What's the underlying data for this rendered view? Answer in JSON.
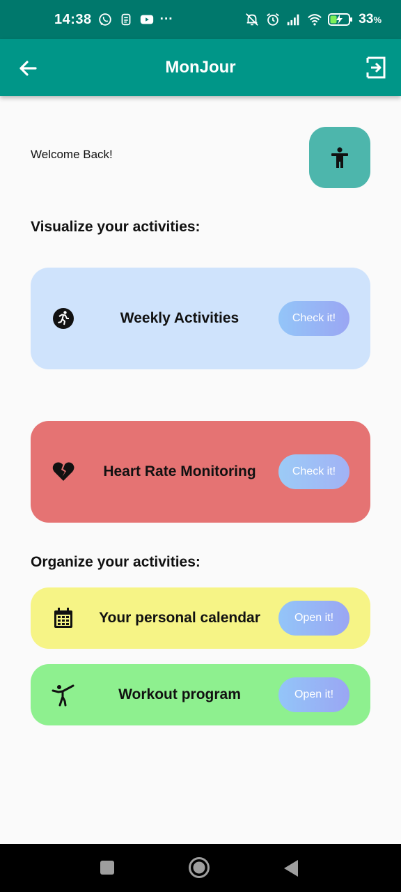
{
  "status_bar": {
    "time": "14:38",
    "battery_percent": "33",
    "battery_unit": "%",
    "more_glyph": "···",
    "icons": [
      "whatsapp-icon",
      "sim-icon",
      "youtube-icon",
      "mute-bell-icon",
      "alarm-icon",
      "signal-icon",
      "wifi-icon",
      "battery-charging-icon"
    ]
  },
  "app_bar": {
    "title": "MonJour",
    "back_icon": "arrow-left-icon",
    "logout_icon": "exit-icon"
  },
  "home": {
    "welcome": "Welcome Back!",
    "accessibility_icon": "accessibility-icon",
    "visualize_title": "Visualize your activities:",
    "organize_title": "Organize your activities:"
  },
  "cards": {
    "weekly": {
      "label": "Weekly Activities",
      "button": "Check it!",
      "icon": "running-icon",
      "color": "#cfe3fc"
    },
    "heart": {
      "label": "Heart Rate Monitoring",
      "button": "Check it!",
      "icon": "broken-heart-icon",
      "color": "#e57373"
    },
    "calendar": {
      "label": "Your personal calendar",
      "button": "Open it!",
      "icon": "calendar-icon",
      "color": "#f6f486"
    },
    "workout": {
      "label": "Workout program",
      "button": "Open it!",
      "icon": "kick-icon",
      "color": "#8ef08f"
    }
  },
  "colors": {
    "status_bar": "#00786c",
    "app_bar": "#009688",
    "accessibility_button": "#4db6ac",
    "button_gradient_start": "#93c5f8",
    "button_gradient_end": "#9aa6f3"
  },
  "nav_bar": {
    "icons": [
      "recents-square-icon",
      "home-circle-icon",
      "back-triangle-icon"
    ]
  }
}
